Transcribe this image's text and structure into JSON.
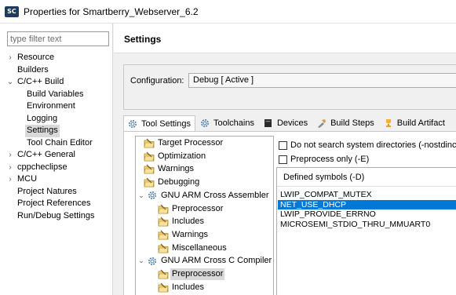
{
  "window": {
    "logo_text": "SC",
    "title": "Properties for Smartberry_Webserver_6.2"
  },
  "filter": {
    "placeholder": "type filter text"
  },
  "nav_tree": [
    {
      "label": "Resource",
      "arrow": "›",
      "level": 0
    },
    {
      "label": "Builders",
      "arrow": "",
      "level": 0
    },
    {
      "label": "C/C++ Build",
      "arrow": "⌄",
      "level": 0
    },
    {
      "label": "Build Variables",
      "arrow": "",
      "level": 1
    },
    {
      "label": "Environment",
      "arrow": "",
      "level": 1
    },
    {
      "label": "Logging",
      "arrow": "",
      "level": 1
    },
    {
      "label": "Settings",
      "arrow": "",
      "level": 1,
      "selected": true
    },
    {
      "label": "Tool Chain Editor",
      "arrow": "",
      "level": 1
    },
    {
      "label": "C/C++ General",
      "arrow": "›",
      "level": 0
    },
    {
      "label": "cppcheclipse",
      "arrow": "›",
      "level": 0
    },
    {
      "label": "MCU",
      "arrow": "›",
      "level": 0
    },
    {
      "label": "Project Natures",
      "arrow": "",
      "level": 0
    },
    {
      "label": "Project References",
      "arrow": "",
      "level": 0
    },
    {
      "label": "Run/Debug Settings",
      "arrow": "",
      "level": 0
    }
  ],
  "settings": {
    "title": "Settings",
    "configuration_label": "Configuration:",
    "configuration_value": "Debug  [ Active ]"
  },
  "tabs": [
    {
      "label": "Tool Settings",
      "icon": "tool-settings-icon",
      "active": true
    },
    {
      "label": "Toolchains",
      "icon": "toolchains-icon"
    },
    {
      "label": "Devices",
      "icon": "devices-icon"
    },
    {
      "label": "Build Steps",
      "icon": "build-steps-icon"
    },
    {
      "label": "Build Artifact",
      "icon": "build-artifact-icon"
    }
  ],
  "tool_tree": [
    {
      "label": "Target Processor",
      "level": 1,
      "type": "folder"
    },
    {
      "label": "Optimization",
      "level": 1,
      "type": "folder"
    },
    {
      "label": "Warnings",
      "level": 1,
      "type": "folder"
    },
    {
      "label": "Debugging",
      "level": 1,
      "type": "folder"
    },
    {
      "label": "GNU ARM Cross Assembler",
      "level": 0,
      "type": "tool",
      "chevron": "⌄"
    },
    {
      "label": "Preprocessor",
      "level": 2,
      "type": "folder"
    },
    {
      "label": "Includes",
      "level": 2,
      "type": "folder"
    },
    {
      "label": "Warnings",
      "level": 2,
      "type": "folder"
    },
    {
      "label": "Miscellaneous",
      "level": 2,
      "type": "folder"
    },
    {
      "label": "GNU ARM Cross C Compiler",
      "level": 0,
      "type": "tool",
      "chevron": "⌄"
    },
    {
      "label": "Preprocessor",
      "level": 2,
      "type": "folder",
      "selected": true
    },
    {
      "label": "Includes",
      "level": 2,
      "type": "folder"
    }
  ],
  "options": {
    "nostdinc": "Do not search system directories (-nostdinc)",
    "preprocess_only": "Preprocess only (-E)"
  },
  "symbols": {
    "header": "Defined symbols (-D)",
    "items": [
      {
        "label": "LWIP_COMPAT_MUTEX"
      },
      {
        "label": "NET_USE_DHCP",
        "selected": true
      },
      {
        "label": "LWIP_PROVIDE_ERRNO"
      },
      {
        "label": "MICROSEMI_STDIO_THRU_MMUART0"
      }
    ]
  },
  "colors": {
    "selection_blue": "#0078d7",
    "tree_selection_gray": "#d9d9d9"
  }
}
